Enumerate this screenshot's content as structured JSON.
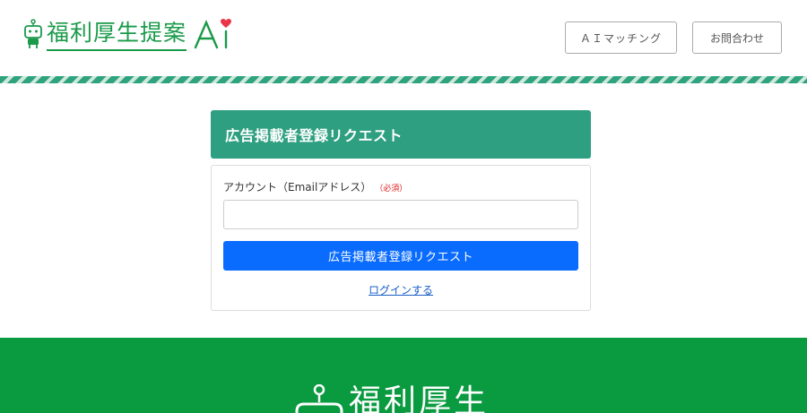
{
  "header": {
    "logo_text": "福利厚生提案",
    "logo_suffix": "Ai",
    "nav": {
      "ai_matching_label": "ＡＩマッチング",
      "contact_label": "お問合わせ"
    }
  },
  "form": {
    "title": "広告掲載者登録リクエスト",
    "account_label": "アカウント（Emailアドレス）",
    "required_label": "（必須）",
    "email_value": "",
    "email_placeholder": "",
    "submit_label": "広告掲載者登録リクエスト",
    "login_link": "ログインする"
  },
  "footer": {
    "logo_text": "福利厚生"
  },
  "colors": {
    "brand_green": "#1a9a4a",
    "panel_green": "#2e9f80",
    "primary_blue": "#0a6cff",
    "footer_green": "#0a9a40",
    "heart_red": "#e8364a"
  },
  "icons": {
    "logo_mark": "robot-mascot-icon",
    "logo_heart": "heart-icon",
    "footer_mark": "robot-mascot-icon"
  }
}
